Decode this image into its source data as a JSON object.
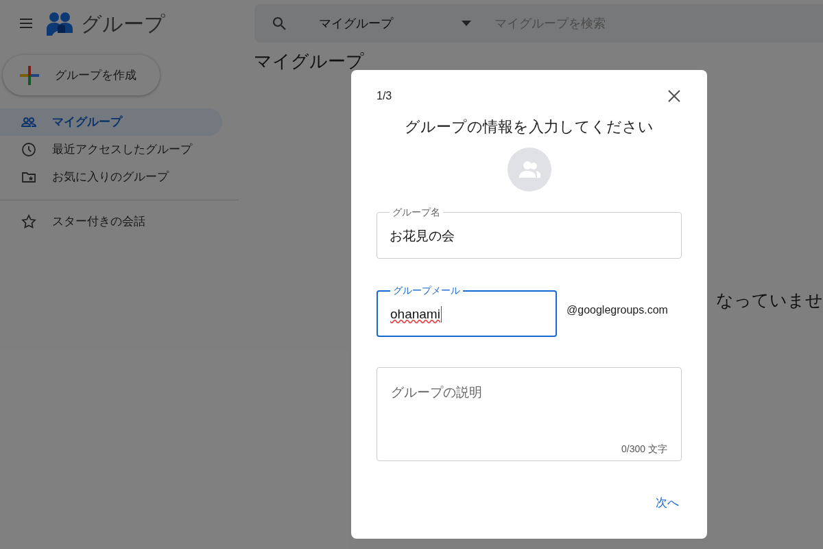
{
  "app": {
    "title": "グループ"
  },
  "search": {
    "scope": "マイグループ",
    "placeholder": "マイグループを検索"
  },
  "create_button": {
    "label": "グループを作成"
  },
  "sidebar": {
    "items": [
      {
        "label": "マイグループ",
        "kind": "people",
        "selected": true
      },
      {
        "label": "最近アクセスしたグループ",
        "kind": "clock",
        "selected": false
      },
      {
        "label": "お気に入りのグループ",
        "kind": "folder",
        "selected": false
      }
    ],
    "starred": {
      "label": "スター付きの会話",
      "kind": "star",
      "selected": false
    }
  },
  "main": {
    "heading": "マイグループ",
    "empty_text": "なっていませ"
  },
  "dialog": {
    "step": "1/3",
    "title": "グループの情報を入力してください",
    "fields": [
      {
        "kind": "text",
        "label": "グループ名",
        "value": "お花見の会",
        "focused": false
      },
      {
        "kind": "email",
        "label": "グループメール",
        "value": "ohanami",
        "suffix": "@googlegroups.com",
        "focused": true
      },
      {
        "kind": "textarea",
        "placeholder": "グループの説明",
        "counter": "0/300 文字",
        "focused": false
      }
    ],
    "next_button": "次へ"
  }
}
